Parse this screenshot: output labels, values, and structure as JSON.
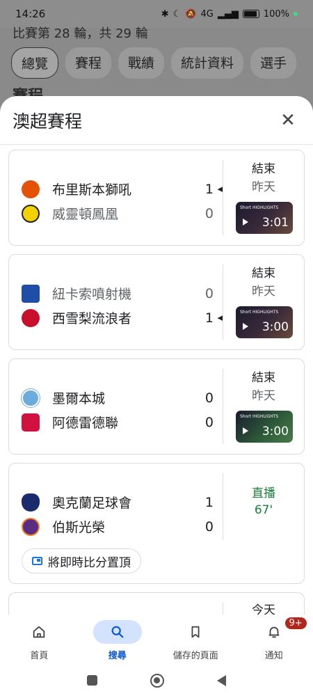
{
  "status_bar": {
    "time": "14:26",
    "network": "4G",
    "battery": "100%"
  },
  "background": {
    "subtitle": "比賽第 28 輪，共 29 輪",
    "tabs": [
      "總覽",
      "賽程",
      "戰績",
      "統計資料",
      "選手"
    ],
    "heading": "賽程"
  },
  "sheet": {
    "title": "澳超賽程",
    "close_icon": "close-icon"
  },
  "matches": [
    {
      "home": {
        "name": "布里斯本獅吼",
        "score": "1",
        "logo_color": "#e35205"
      },
      "away": {
        "name": "威靈頓鳳凰",
        "score": "0",
        "logo_color": "#f2d200"
      },
      "winner": "home",
      "status": "結束",
      "date": "昨天",
      "video": {
        "brand": "Short HIGHLIGHTS",
        "duration": "3:01"
      }
    },
    {
      "home": {
        "name": "紐卡索噴射機",
        "score": "0",
        "logo_color": "#1f4ea8"
      },
      "away": {
        "name": "西雪梨流浪者",
        "score": "1",
        "logo_color": "#c8102e"
      },
      "winner": "away",
      "status": "結束",
      "date": "昨天",
      "video": {
        "brand": "Short HIGHLIGHTS",
        "duration": "3:00"
      }
    },
    {
      "home": {
        "name": "墨爾本城",
        "score": "0",
        "logo_color": "#6cabdd"
      },
      "away": {
        "name": "阿德雷德聯",
        "score": "0",
        "logo_color": "#d11241"
      },
      "winner": "none",
      "status": "結束",
      "date": "昨天",
      "video": {
        "brand": "Short HIGHLIGHTS",
        "duration": "3:00"
      }
    },
    {
      "home": {
        "name": "奧克蘭足球會",
        "score": "1",
        "logo_color": "#1a2b6d"
      },
      "away": {
        "name": "伯斯光榮",
        "score": "0",
        "logo_color": "#5b2c83"
      },
      "winner": "none",
      "status": "直播",
      "minute": "67'",
      "pin_label": "將即時比分置頂"
    }
  ],
  "partial_card": {
    "status": "今天"
  },
  "bottom_nav": {
    "items": [
      {
        "label": "首頁",
        "icon": "home-icon"
      },
      {
        "label": "搜尋",
        "icon": "search-icon"
      },
      {
        "label": "儲存的頁面",
        "icon": "bookmark-icon"
      },
      {
        "label": "通知",
        "icon": "bell-icon"
      }
    ],
    "active": "搜尋",
    "notification_badge": "9+"
  },
  "colors": {
    "accent": "#0b57d0",
    "live": "#188038",
    "nav_active_bg": "#d3e3fd"
  }
}
